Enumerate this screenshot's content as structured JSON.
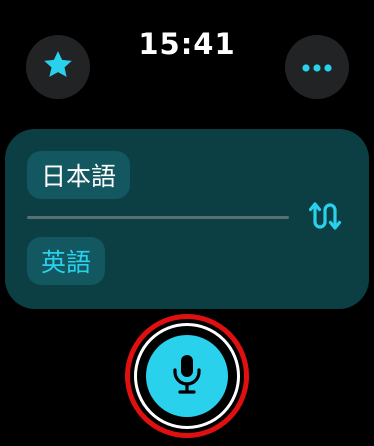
{
  "status": {
    "time": "15:41"
  },
  "toolbar": {
    "favorite_icon": "star-icon",
    "more_icon": "ellipsis-icon"
  },
  "languages": {
    "source": "日本語",
    "target": "英語",
    "swap_icon": "swap-arrows-icon"
  },
  "mic": {
    "icon": "microphone-icon"
  },
  "colors": {
    "accent": "#29d1ec",
    "card_bg": "#0b3f44",
    "pill_bg": "#135760",
    "button_bg": "#222325",
    "highlight_ring": "#e01010"
  }
}
